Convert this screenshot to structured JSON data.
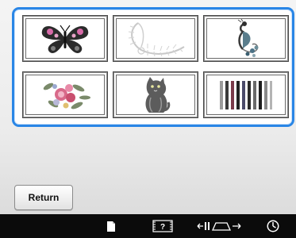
{
  "designs": [
    {
      "name": "butterfly-design",
      "icon": "butterfly-icon"
    },
    {
      "name": "feather-design",
      "icon": "feather-icon"
    },
    {
      "name": "peacock-design",
      "icon": "peacock-icon"
    },
    {
      "name": "flower-bouquet-design",
      "icon": "flower-bouquet-icon"
    },
    {
      "name": "cat-design",
      "icon": "cat-icon"
    },
    {
      "name": "bar-pattern-design",
      "icon": "bar-pattern-icon"
    }
  ],
  "buttons": {
    "return_label": "Return"
  },
  "status_bar": {
    "icons": [
      "page-icon",
      "help-icon",
      "stitch-width-icon",
      "clock-icon"
    ]
  },
  "colors": {
    "selection_border": "#2a86e6",
    "status_bar_bg": "#0b0b0b"
  }
}
